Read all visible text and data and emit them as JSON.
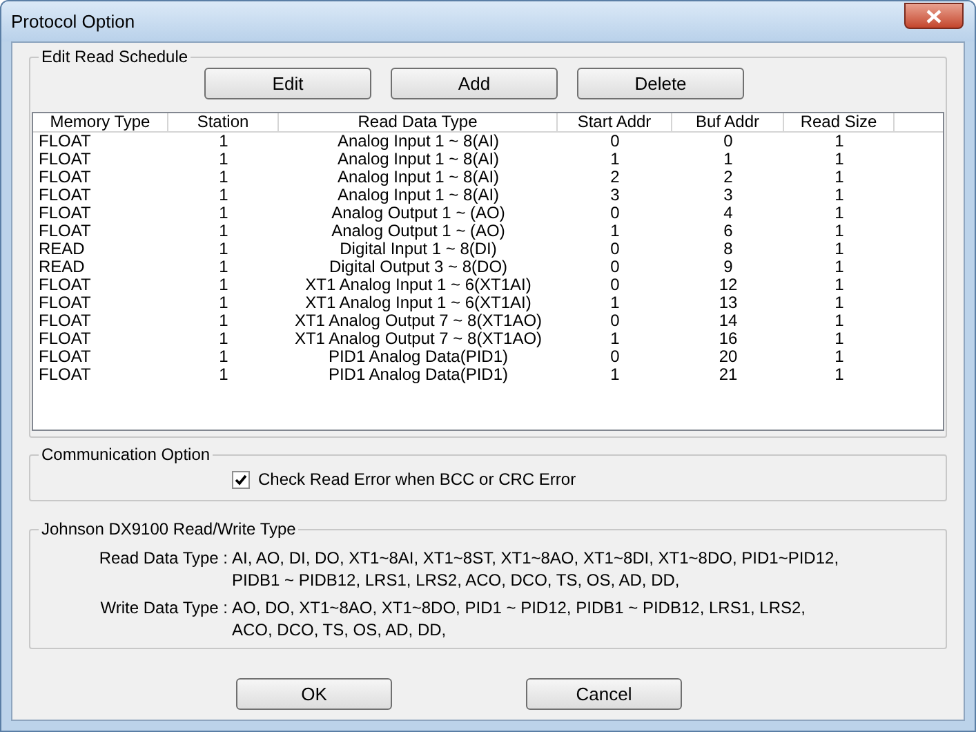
{
  "window": {
    "title": "Protocol Option"
  },
  "schedule": {
    "title": "Edit Read Schedule",
    "buttons": [
      "Edit",
      "Add",
      "Delete"
    ],
    "columns": [
      "Memory Type",
      "Station",
      "Read Data Type",
      "Start Addr",
      "Buf Addr",
      "Read Size"
    ],
    "rows": [
      [
        "FLOAT",
        "1",
        "Analog Input 1 ~ 8(AI)",
        "0",
        "0",
        "1"
      ],
      [
        "FLOAT",
        "1",
        "Analog Input 1 ~ 8(AI)",
        "1",
        "1",
        "1"
      ],
      [
        "FLOAT",
        "1",
        "Analog Input 1 ~ 8(AI)",
        "2",
        "2",
        "1"
      ],
      [
        "FLOAT",
        "1",
        "Analog Input 1 ~ 8(AI)",
        "3",
        "3",
        "1"
      ],
      [
        "FLOAT",
        "1",
        "Analog Output 1 ~ (AO)",
        "0",
        "4",
        "1"
      ],
      [
        "FLOAT",
        "1",
        "Analog Output 1 ~ (AO)",
        "1",
        "6",
        "1"
      ],
      [
        "READ",
        "1",
        "Digital Input 1 ~ 8(DI)",
        "0",
        "8",
        "1"
      ],
      [
        "READ",
        "1",
        "Digital Output 3 ~ 8(DO)",
        "0",
        "9",
        "1"
      ],
      [
        "FLOAT",
        "1",
        "XT1 Analog Input 1 ~ 6(XT1AI)",
        "0",
        "12",
        "1"
      ],
      [
        "FLOAT",
        "1",
        "XT1 Analog Input 1 ~ 6(XT1AI)",
        "1",
        "13",
        "1"
      ],
      [
        "FLOAT",
        "1",
        "XT1 Analog Output 7 ~ 8(XT1AO)",
        "0",
        "14",
        "1"
      ],
      [
        "FLOAT",
        "1",
        "XT1 Analog Output 7 ~ 8(XT1AO)",
        "1",
        "16",
        "1"
      ],
      [
        "FLOAT",
        "1",
        "PID1 Analog Data(PID1)",
        "0",
        "20",
        "1"
      ],
      [
        "FLOAT",
        "1",
        "PID1 Analog Data(PID1)",
        "1",
        "21",
        "1"
      ]
    ]
  },
  "communication": {
    "title": "Communication Option",
    "checkbox": {
      "label": "Check Read Error when BCC or CRC Error",
      "checked": true
    }
  },
  "types": {
    "title": "Johnson DX9100 Read/Write Type",
    "entries": [
      {
        "label": "Read Data Type :",
        "lines": [
          "AI, AO, DI, DO, XT1~8AI, XT1~8ST, XT1~8AO, XT1~8DI, XT1~8DO, PID1~PID12,",
          "PIDB1 ~ PIDB12, LRS1, LRS2, ACO, DCO, TS, OS, AD, DD,"
        ]
      },
      {
        "label": "Write Data Type :",
        "lines": [
          "AO, DO, XT1~8AO, XT1~8DO, PID1 ~ PID12, PIDB1 ~ PIDB12, LRS1, LRS2,",
          "ACO, DCO, TS, OS, AD, DD,"
        ]
      }
    ]
  },
  "buttons": [
    "OK",
    "Cancel"
  ]
}
